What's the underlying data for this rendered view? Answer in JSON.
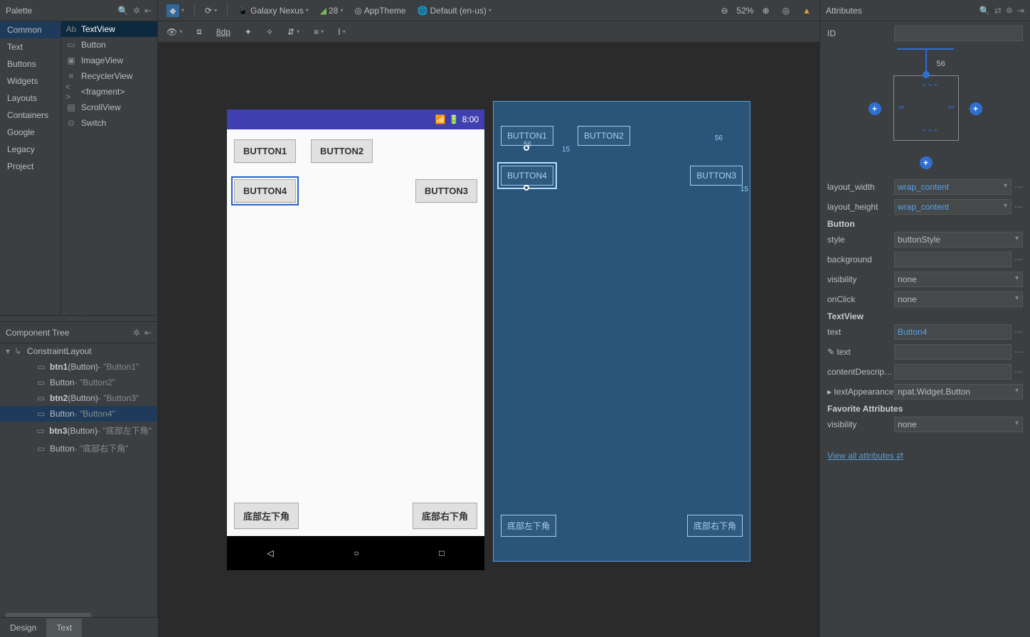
{
  "palette": {
    "title": "Palette",
    "categories": [
      "Common",
      "Text",
      "Buttons",
      "Widgets",
      "Layouts",
      "Containers",
      "Google",
      "Legacy",
      "Project"
    ],
    "selected_category": 0,
    "items": [
      "TextView",
      "Button",
      "ImageView",
      "RecyclerView",
      "<fragment>",
      "ScrollView",
      "Switch"
    ],
    "item_prefix": [
      "Ab",
      "",
      "",
      "",
      "< >",
      "",
      ""
    ],
    "selected_item": 0
  },
  "component_tree": {
    "title": "Component Tree",
    "root": "ConstraintLayout",
    "nodes": [
      {
        "bold": "btn1",
        "mid": " (Button)",
        "suffix": " - \"Button1\""
      },
      {
        "bold": "",
        "mid": "Button",
        "suffix": " - \"Button2\""
      },
      {
        "bold": "btn2",
        "mid": " (Button)",
        "suffix": " - \"Button3\""
      },
      {
        "bold": "",
        "mid": "Button",
        "suffix": " - \"Button4\""
      },
      {
        "bold": "btn3",
        "mid": " (Button)",
        "suffix": " - \"底部左下角\""
      },
      {
        "bold": "",
        "mid": "Button",
        "suffix": " - \"底部右下角\""
      }
    ],
    "selected": 3
  },
  "toolbar": {
    "device": "Galaxy Nexus",
    "api": "28",
    "theme": "AppTheme",
    "locale": "Default (en-us)",
    "zoom": "52%",
    "grid_value": "8dp"
  },
  "preview": {
    "time": "8:00",
    "buttons": {
      "b1": "BUTTON1",
      "b2": "BUTTON2",
      "b3": "BUTTON3",
      "b4": "BUTTON4",
      "b5": "底部左下角",
      "b6": "底部右下角"
    }
  },
  "blueprint": {
    "margin_top": "56",
    "margin_side": "15"
  },
  "attributes": {
    "title": "Attributes",
    "id_label": "ID",
    "id_value": "",
    "constraint_top": "56",
    "layout_width_label": "layout_width",
    "layout_width": "wrap_content",
    "layout_height_label": "layout_height",
    "layout_height": "wrap_content",
    "section_button": "Button",
    "style_label": "style",
    "style": "buttonStyle",
    "background_label": "background",
    "background": "",
    "visibility_label": "visibility",
    "visibility": "none",
    "onClick_label": "onClick",
    "onClick": "none",
    "section_textview": "TextView",
    "text_label": "text",
    "text": "Button4",
    "text2_label": "text",
    "text2": "",
    "contentDesc_label": "contentDescription",
    "contentDesc": "",
    "textAppearance_label": "textAppearance",
    "textAppearance": "npat.Widget.Button",
    "section_fav": "Favorite Attributes",
    "fav_visibility_label": "visibility",
    "fav_visibility": "none",
    "view_all": "View all attributes"
  },
  "tabs": {
    "design": "Design",
    "text": "Text"
  }
}
